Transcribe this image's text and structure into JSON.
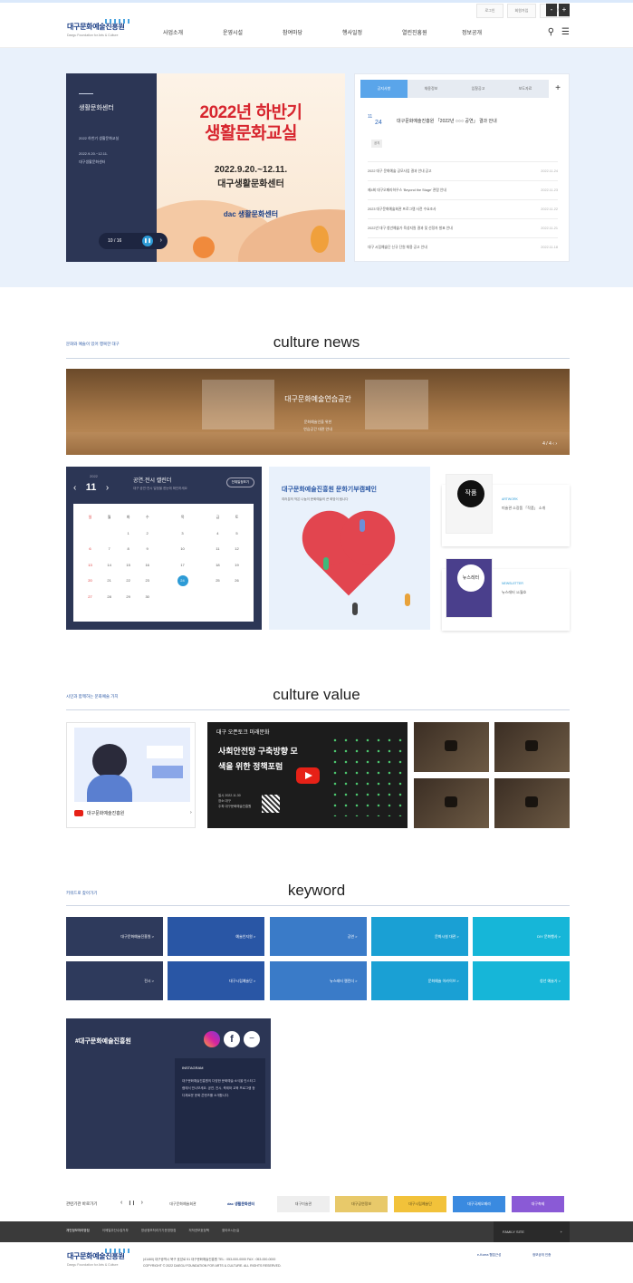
{
  "utility": {
    "links": [
      "로그인",
      "회원가입",
      "사이트맵"
    ],
    "btn_minus": "-",
    "btn_plus": "+"
  },
  "header": {
    "logo_text": "대구문화예술진흥원",
    "logo_sub": "Daegu Foundation for Arts & Culture",
    "nav": [
      "사업소개",
      "운영시설",
      "참여마당",
      "행사일정",
      "열린진흥원",
      "정보공개"
    ]
  },
  "visual": {
    "left_title": "생활문화센터",
    "left_lines": [
      "2022 하반기 생활문화교실",
      "2022.9.20.~12.11.",
      "대구생활문화센터"
    ],
    "slide_counter": "10 / 16",
    "poster_title_1": "2022년 하반기",
    "poster_title_2": "생활문화교실",
    "poster_date": "2022.9.20.~12.11.",
    "poster_venue": "대구생활문화센터",
    "poster_brand": "dac 생활문화센터"
  },
  "notice": {
    "tabs": [
      "공지사항",
      "채용정보",
      "입찰공고",
      "보도자료"
    ],
    "plus": "+",
    "featured": {
      "month": "11",
      "day": "24",
      "title": "대구문화예술진흥원 「2022년 ○○○ 공연」 결과 안내",
      "tag": "공지"
    },
    "items": [
      {
        "title": "2022 대구 문화예술 공모사업 결과 안내 공고",
        "date": "2022.11.24"
      },
      {
        "title": "제4회 대구오페라하우스 'Beyond the Stage' 관람 안내",
        "date": "2022.11.23"
      },
      {
        "title": "2023 대구문화예술회관 프로그램 사전 수요조사",
        "date": "2022.11.22"
      },
      {
        "title": "2022년 대구 청년예술가 육성지원 결과 및 선정자 발표 안내",
        "date": "2022.11.21"
      },
      {
        "title": "대구 시립예술단 신규 단원 채용 공고 안내",
        "date": "2022.11.18"
      }
    ]
  },
  "culture_news": {
    "title": "culture news",
    "subtitle": "문화와 예술이 있어 행복한 대구",
    "banner_caption": "대구문화예술연습공간",
    "banner_sub_1": "문화예술인을 위한",
    "banner_sub_2": "연습공간 대관 안내",
    "banner_page": "4 / 4"
  },
  "calendar": {
    "year": "2022",
    "month": "11",
    "prev": "‹",
    "next": "›",
    "title": "공연·전시 캘린더",
    "subtitle": "대구 공연·전시 일정을 한눈에 확인하세요",
    "button": "전체일정보기",
    "weekdays": [
      "일",
      "월",
      "화",
      "수",
      "목",
      "금",
      "토"
    ],
    "weeks": [
      [
        "",
        "",
        "1",
        "2",
        "3",
        "4",
        "5"
      ],
      [
        "6",
        "7",
        "8",
        "9",
        "10",
        "11",
        "12"
      ],
      [
        "13",
        "14",
        "15",
        "16",
        "17",
        "18",
        "19"
      ],
      [
        "20",
        "21",
        "22",
        "23",
        "24",
        "25",
        "26"
      ],
      [
        "27",
        "28",
        "29",
        "30",
        "",
        "",
        ""
      ]
    ],
    "today": "24"
  },
  "donation": {
    "title": "대구문화예술진흥원 문화기부캠페인",
    "subtitle": "여러분의 작은 나눔이 문화예술의 큰 희망이 됩니다"
  },
  "side_cards": [
    {
      "thumb_text": "작품",
      "category": "ARTWORK",
      "title": "미술관 소장품 「작품」 소개"
    },
    {
      "thumb_text": "뉴스레터",
      "category": "NEWSLETTER",
      "title": "뉴스레터 11월호"
    }
  ],
  "culture_value": {
    "title": "culture value",
    "subtitle": "시민과 함께하는 문화예술 가치",
    "video1_label": "대구문화예술진흥원",
    "video2_header": "대구 오픈토크 미래문화",
    "video2_title": "사회안전망 구축방향 모색을 위한 정책포럼",
    "video2_info": [
      "일시 2022.11.30",
      "장소 대구",
      "주최 대구문화예술진흥원"
    ]
  },
  "keyword": {
    "title": "keyword",
    "subtitle": "키워드로 찾아가기",
    "items": [
      "대구문화예술진흥원",
      "예술인지원",
      "공연",
      "문화시설 대관",
      "DIY 문화행사",
      "전시",
      "대구시립예술단",
      "뉴스레터 캘린더",
      "문화예술 아카이브",
      "청년 예술가"
    ],
    "colors": [
      "#2e3a5c",
      "#2956a5",
      "#3a7bc8",
      "#1aa0d4",
      "#16b6d8",
      "#2e3a5c",
      "#2956a5",
      "#3a7bc8",
      "#1aa0d4",
      "#16b6d8"
    ]
  },
  "instagram": {
    "title": "#대구문화예술진흥원",
    "panel_title": "INSTAGRAM",
    "panel_text": "대구문화예술진흥원의 다양한 문화예술 소식을 인스타그램에서 만나보세요. 공연, 전시, 축제와 교육 프로그램 등 다채로운 문화 콘텐츠를 소개합니다."
  },
  "partners": {
    "label": "관련기관 바로가기",
    "prev": "‹",
    "pause": "❙❙",
    "next": "›",
    "logos": [
      "대구문화예술회관",
      "dac 생활문화센터",
      "대구미술관",
      "대구공연정보",
      "대구시립예술단",
      "대구국제오페라",
      "대구축제"
    ]
  },
  "footer": {
    "links": [
      "개인정보처리방침",
      "이메일무단수집거부",
      "영상정보처리기기운영방침",
      "저작권보호정책",
      "찾아오시는길"
    ],
    "family_site": "FAMILY SITE",
    "address": "(41460) 대구광역시 북구 호암로 51 대구문화예술진흥원   TEL : 053-000-0000   FAX : 053-000-0000",
    "copyright": "COPYRIGHT © 2022 DAEGU FOUNDATION FOR ARTS & CULTURE. ALL RIGHTS RESERVED.",
    "badges": [
      "e-Korea 웹접근성",
      "정보공개 인증"
    ]
  }
}
